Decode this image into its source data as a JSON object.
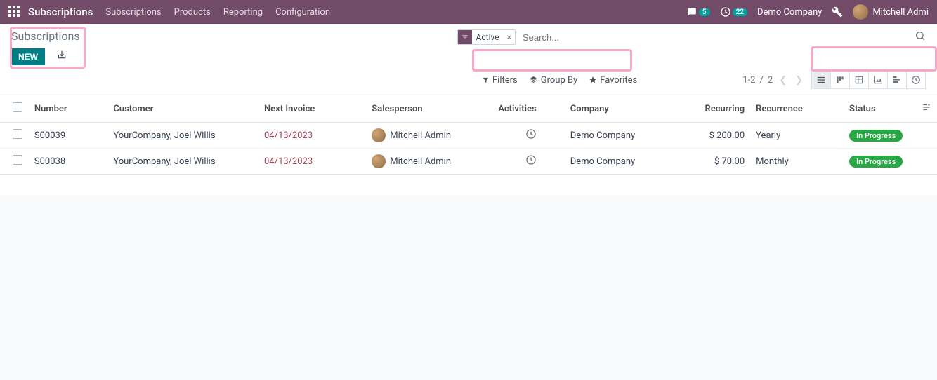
{
  "navbar": {
    "brand": "Subscriptions",
    "menu": [
      "Subscriptions",
      "Products",
      "Reporting",
      "Configuration"
    ],
    "messages_count": "5",
    "activities_count": "22",
    "company": "Demo Company",
    "user": "Mitchell Admi"
  },
  "page": {
    "title": "Subscriptions",
    "new_btn": "NEW"
  },
  "search": {
    "facet_label": "Active",
    "placeholder": "Search...",
    "filters": "Filters",
    "groupby": "Group By",
    "favorites": "Favorites"
  },
  "pager": {
    "range": "1-2",
    "sep": "/",
    "total": "2"
  },
  "columns": {
    "number": "Number",
    "customer": "Customer",
    "next_invoice": "Next Invoice",
    "salesperson": "Salesperson",
    "activities": "Activities",
    "company": "Company",
    "recurring": "Recurring",
    "recurrence": "Recurrence",
    "status": "Status"
  },
  "rows": [
    {
      "number": "S00039",
      "customer": "YourCompany, Joel Willis",
      "next_invoice": "04/13/2023",
      "salesperson": "Mitchell Admin",
      "company": "Demo Company",
      "recurring": "$ 200.00",
      "recurrence": "Yearly",
      "status": "In Progress"
    },
    {
      "number": "S00038",
      "customer": "YourCompany, Joel Willis",
      "next_invoice": "04/13/2023",
      "salesperson": "Mitchell Admin",
      "company": "Demo Company",
      "recurring": "$ 70.00",
      "recurrence": "Monthly",
      "status": "In Progress"
    }
  ]
}
